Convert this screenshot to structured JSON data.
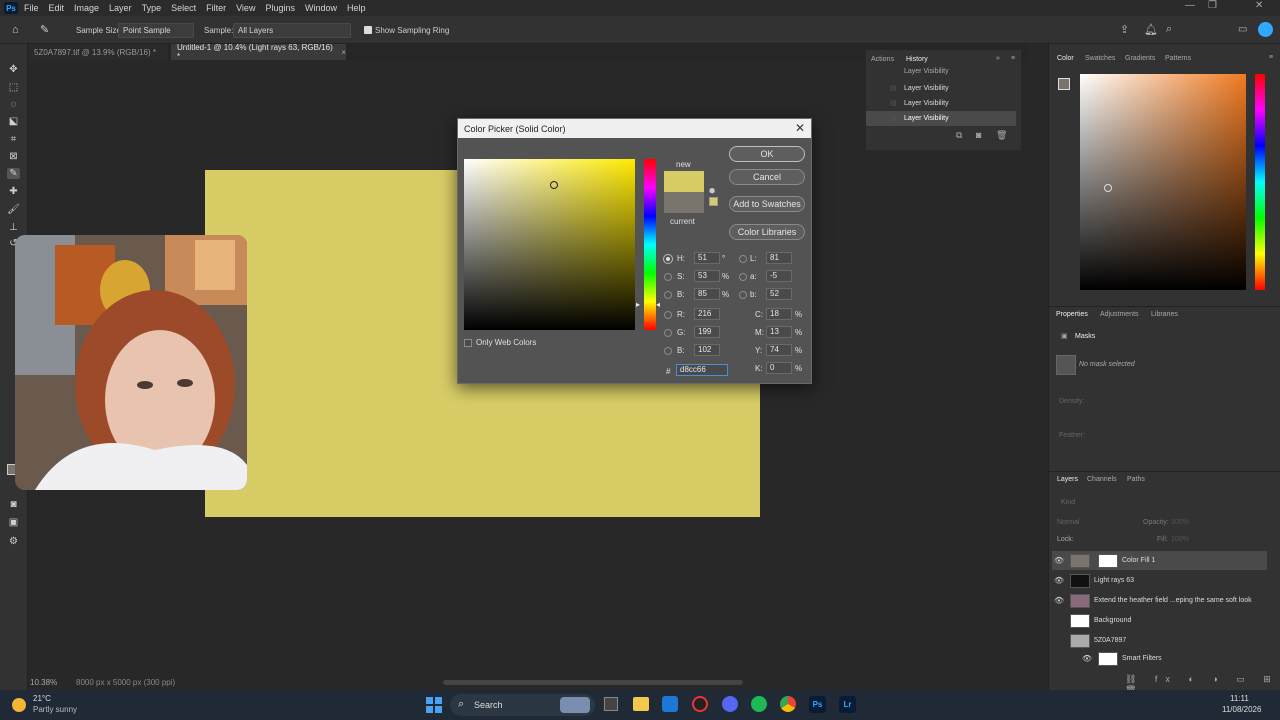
{
  "menubar": {
    "items": [
      "File",
      "Edit",
      "Image",
      "Layer",
      "Type",
      "Select",
      "Filter",
      "View",
      "Plugins",
      "Window",
      "Help"
    ]
  },
  "options": {
    "sample_size_label": "Sample Size:",
    "sample_size_value": "Point Sample",
    "sample_label": "Sample:",
    "sample_value": "All Layers",
    "show_ring_label": "Show Sampling Ring"
  },
  "tabs": [
    {
      "label": "5Z0A7897.tif @ 13.9% (RGB/16) *"
    },
    {
      "label": "Untitled-1 @ 10.4% (Light rays 63, RGB/16) *"
    }
  ],
  "status": {
    "zoom": "10.38%",
    "doc_info": "8000 px x 5000 px (300 ppi)"
  },
  "history": {
    "tabs": [
      "Actions",
      "History"
    ],
    "items": [
      "Layer Visibility",
      "Layer Visibility",
      "Layer Visibility",
      "Layer Visibility"
    ]
  },
  "color_picker": {
    "title": "Color Picker (Solid Color)",
    "new_label": "new",
    "current_label": "current",
    "new_color": "#d8cc66",
    "current_color": "#7a756c",
    "ok": "OK",
    "cancel": "Cancel",
    "add_swatches": "Add to Swatches",
    "color_libraries": "Color Libraries",
    "only_web": "Only Web Colors",
    "H": "51",
    "S": "53",
    "B": "85",
    "R": "216",
    "G": "199",
    "Bv": "102",
    "L": "81",
    "a": "-5",
    "b": "52",
    "C": "18",
    "M": "13",
    "Y": "74",
    "K": "0",
    "deg": "°",
    "pct": "%",
    "hex_hash": "#",
    "hex": "d8cc66"
  },
  "panels": {
    "color_tabs": [
      "Color",
      "Swatches",
      "Gradients",
      "Patterns"
    ],
    "prop_tabs": [
      "Properties",
      "Adjustments",
      "Libraries"
    ],
    "masks_label": "Masks",
    "no_mask": "No mask selected",
    "density": "Density:",
    "feather": "Feather:",
    "layer_tabs": [
      "Layers",
      "Channels",
      "Paths"
    ],
    "kind": "Kind",
    "blend": "Normal",
    "opacity_label": "Opacity:",
    "opacity_value": "100%",
    "lock_label": "Lock:",
    "fill_label": "Fill:",
    "fill_value": "100%"
  },
  "layers": [
    {
      "name": "Color Fill 1"
    },
    {
      "name": "Light rays 63"
    },
    {
      "name": "Extend the heather field ...eping the same soft look"
    },
    {
      "name": "Background"
    },
    {
      "name": "5Z0A7897"
    },
    {
      "name": "Smart Filters"
    }
  ],
  "taskbar": {
    "weather_temp": "21°C",
    "weather_desc": "Partly sunny",
    "search": "Search",
    "time": "11:11",
    "date": "11/08/2026"
  },
  "colors": {
    "fill": "#d8cc66",
    "accent": "#31a8ff"
  }
}
